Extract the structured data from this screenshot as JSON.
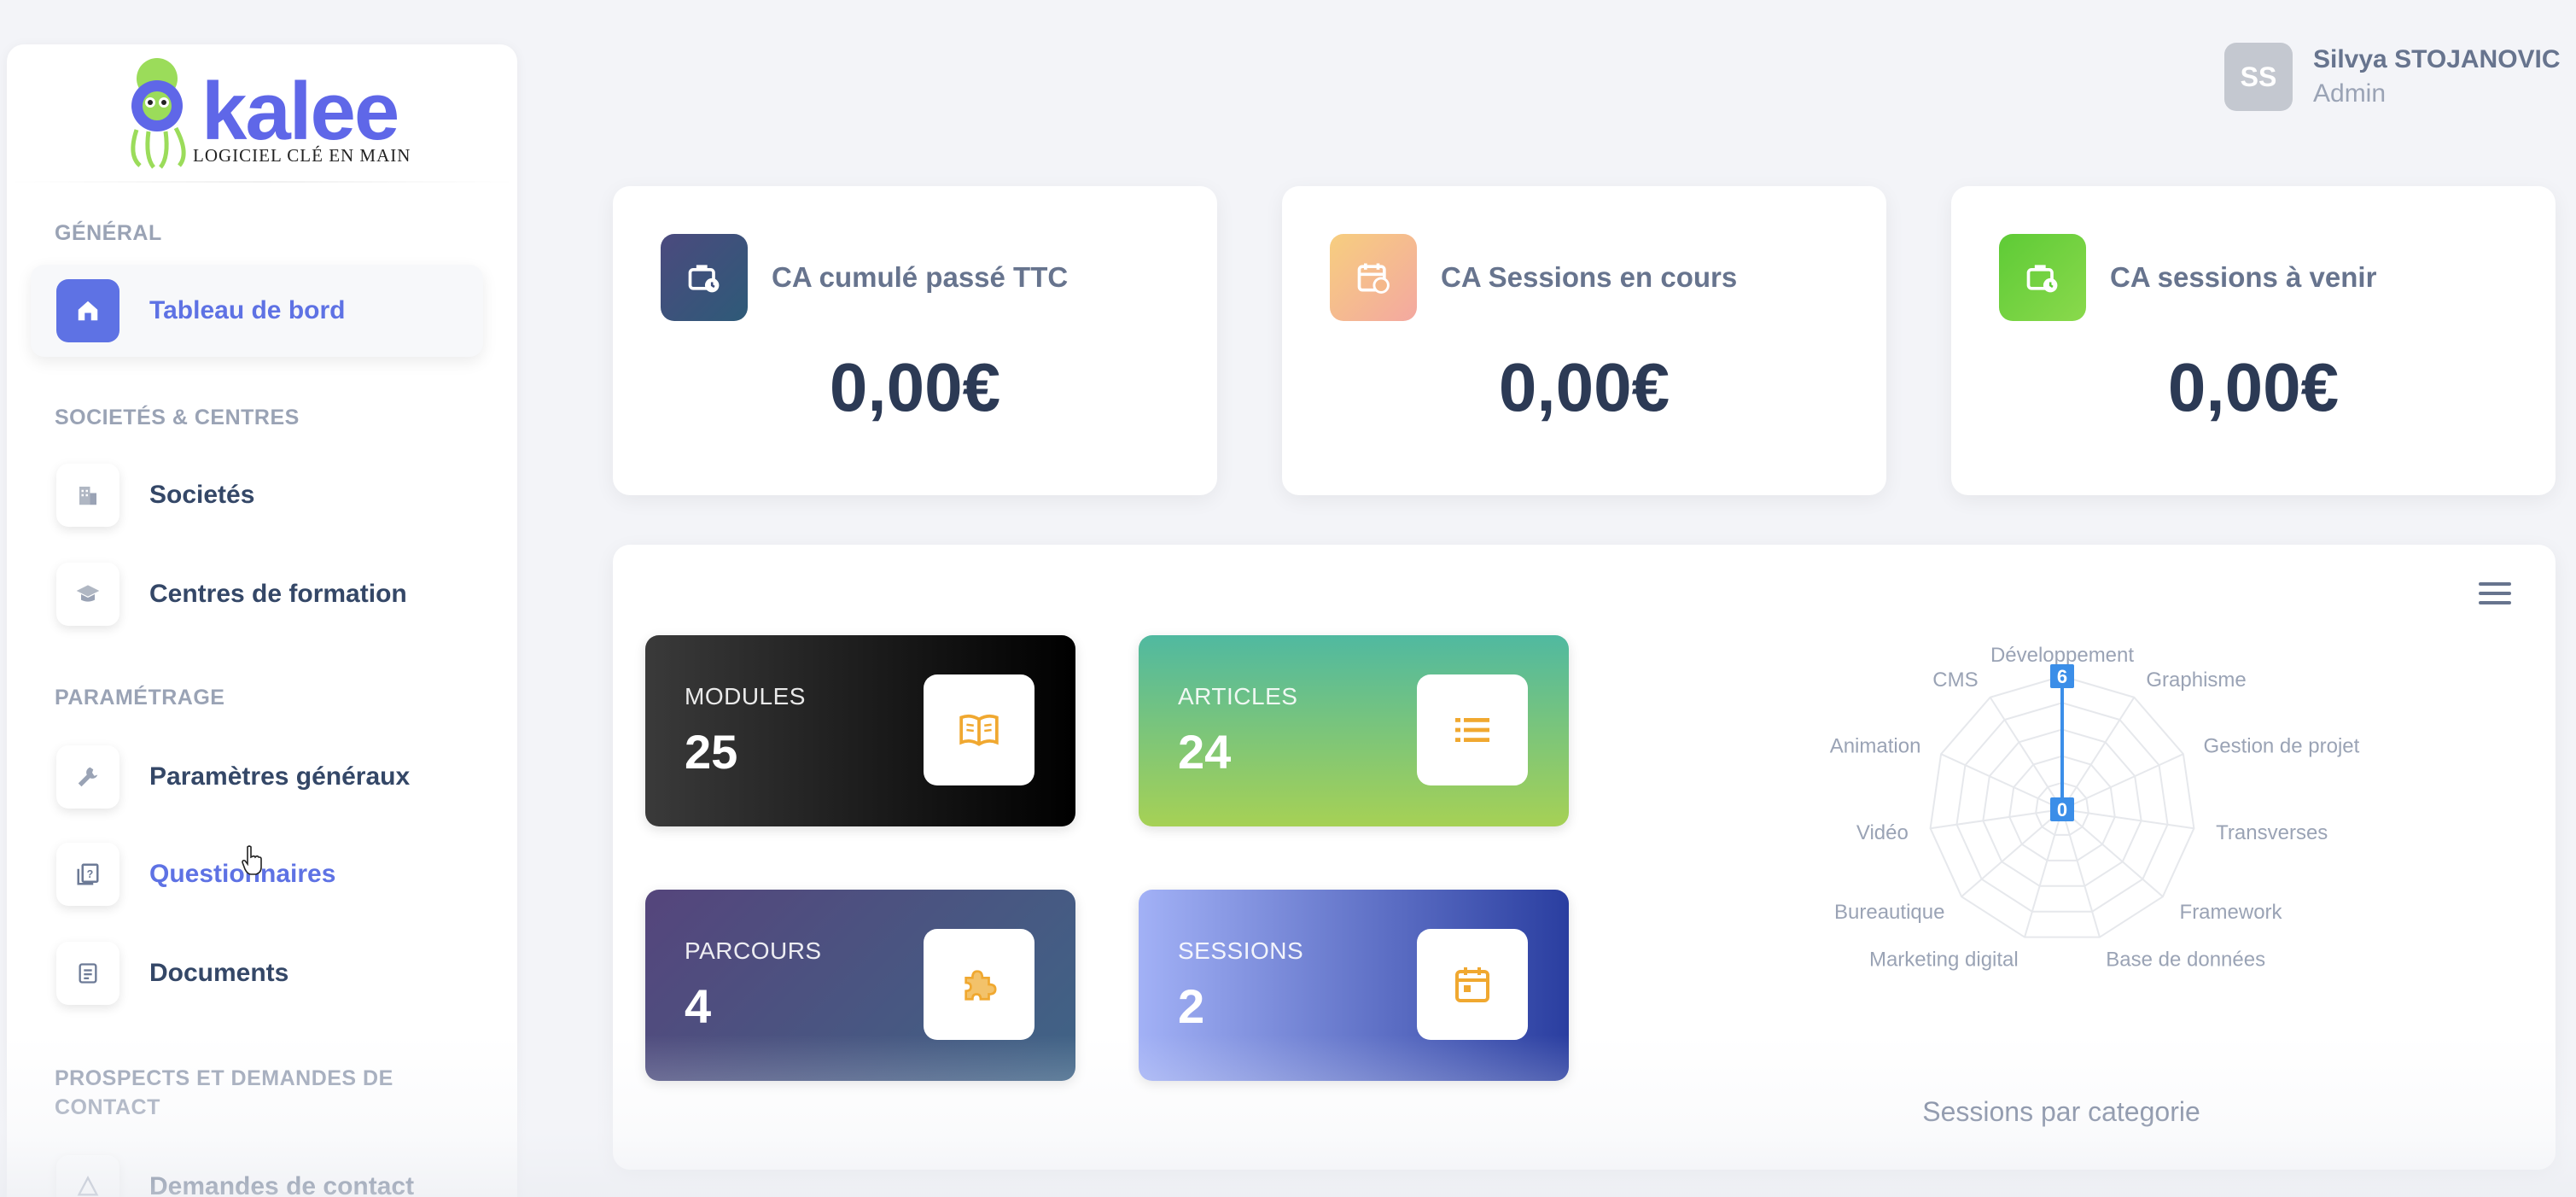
{
  "app": {
    "logo_text": "kalee",
    "logo_tagline": "LOGICIEL CLÉ EN MAIN"
  },
  "sidebar": {
    "sections": [
      {
        "title": "GÉNÉRAL"
      },
      {
        "title": "SOCIETÉS & CENTRES"
      },
      {
        "title": "PARAMÉTRAGE"
      },
      {
        "title": "PROSPECTS ET DEMANDES DE CONTACT"
      }
    ],
    "items": [
      {
        "label": "Tableau de bord",
        "icon": "home-icon",
        "active": true
      },
      {
        "label": "Societés",
        "icon": "building-icon"
      },
      {
        "label": "Centres de formation",
        "icon": "graduation-cap-icon"
      },
      {
        "label": "Paramètres généraux",
        "icon": "wrench-icon"
      },
      {
        "label": "Questionnaires",
        "icon": "question-book-icon"
      },
      {
        "label": "Documents",
        "icon": "document-icon"
      },
      {
        "label": "Demandes de contact",
        "icon": "contact-icon"
      }
    ]
  },
  "user": {
    "initials": "SS",
    "name": "Silvya STOJANOVIC",
    "role": "Admin"
  },
  "stats": [
    {
      "title": "CA cumulé passé TTC",
      "value": "0,00€",
      "icon": "briefcase-clock-icon",
      "color": "#3a4a7a"
    },
    {
      "title": "CA Sessions en cours",
      "value": "0,00€",
      "icon": "calendar-refresh-icon",
      "color": "#f3b27a"
    },
    {
      "title": "CA sessions à venir",
      "value": "0,00€",
      "icon": "briefcase-clock-icon",
      "color": "#6fcf3c"
    }
  ],
  "tiles": [
    {
      "label": "MODULES",
      "value": "25",
      "icon": "book-icon"
    },
    {
      "label": "ARTICLES",
      "value": "24",
      "icon": "list-icon"
    },
    {
      "label": "PARCOURS",
      "value": "4",
      "icon": "puzzle-icon"
    },
    {
      "label": "SESSIONS",
      "value": "2",
      "icon": "calendar-icon"
    }
  ],
  "chart_data": {
    "type": "radar",
    "title": "Sessions par categorie",
    "categories": [
      "Développement",
      "Graphisme",
      "Gestion de projet",
      "Transverses",
      "Framework",
      "Base de données",
      "Marketing digital",
      "Bureautique",
      "Vidéo",
      "Animation",
      "CMS"
    ],
    "values": [
      6,
      0,
      0,
      0,
      0,
      0,
      0,
      0,
      0,
      0,
      0
    ],
    "labels_shown": [
      "6",
      "0"
    ],
    "rmax": 6
  }
}
